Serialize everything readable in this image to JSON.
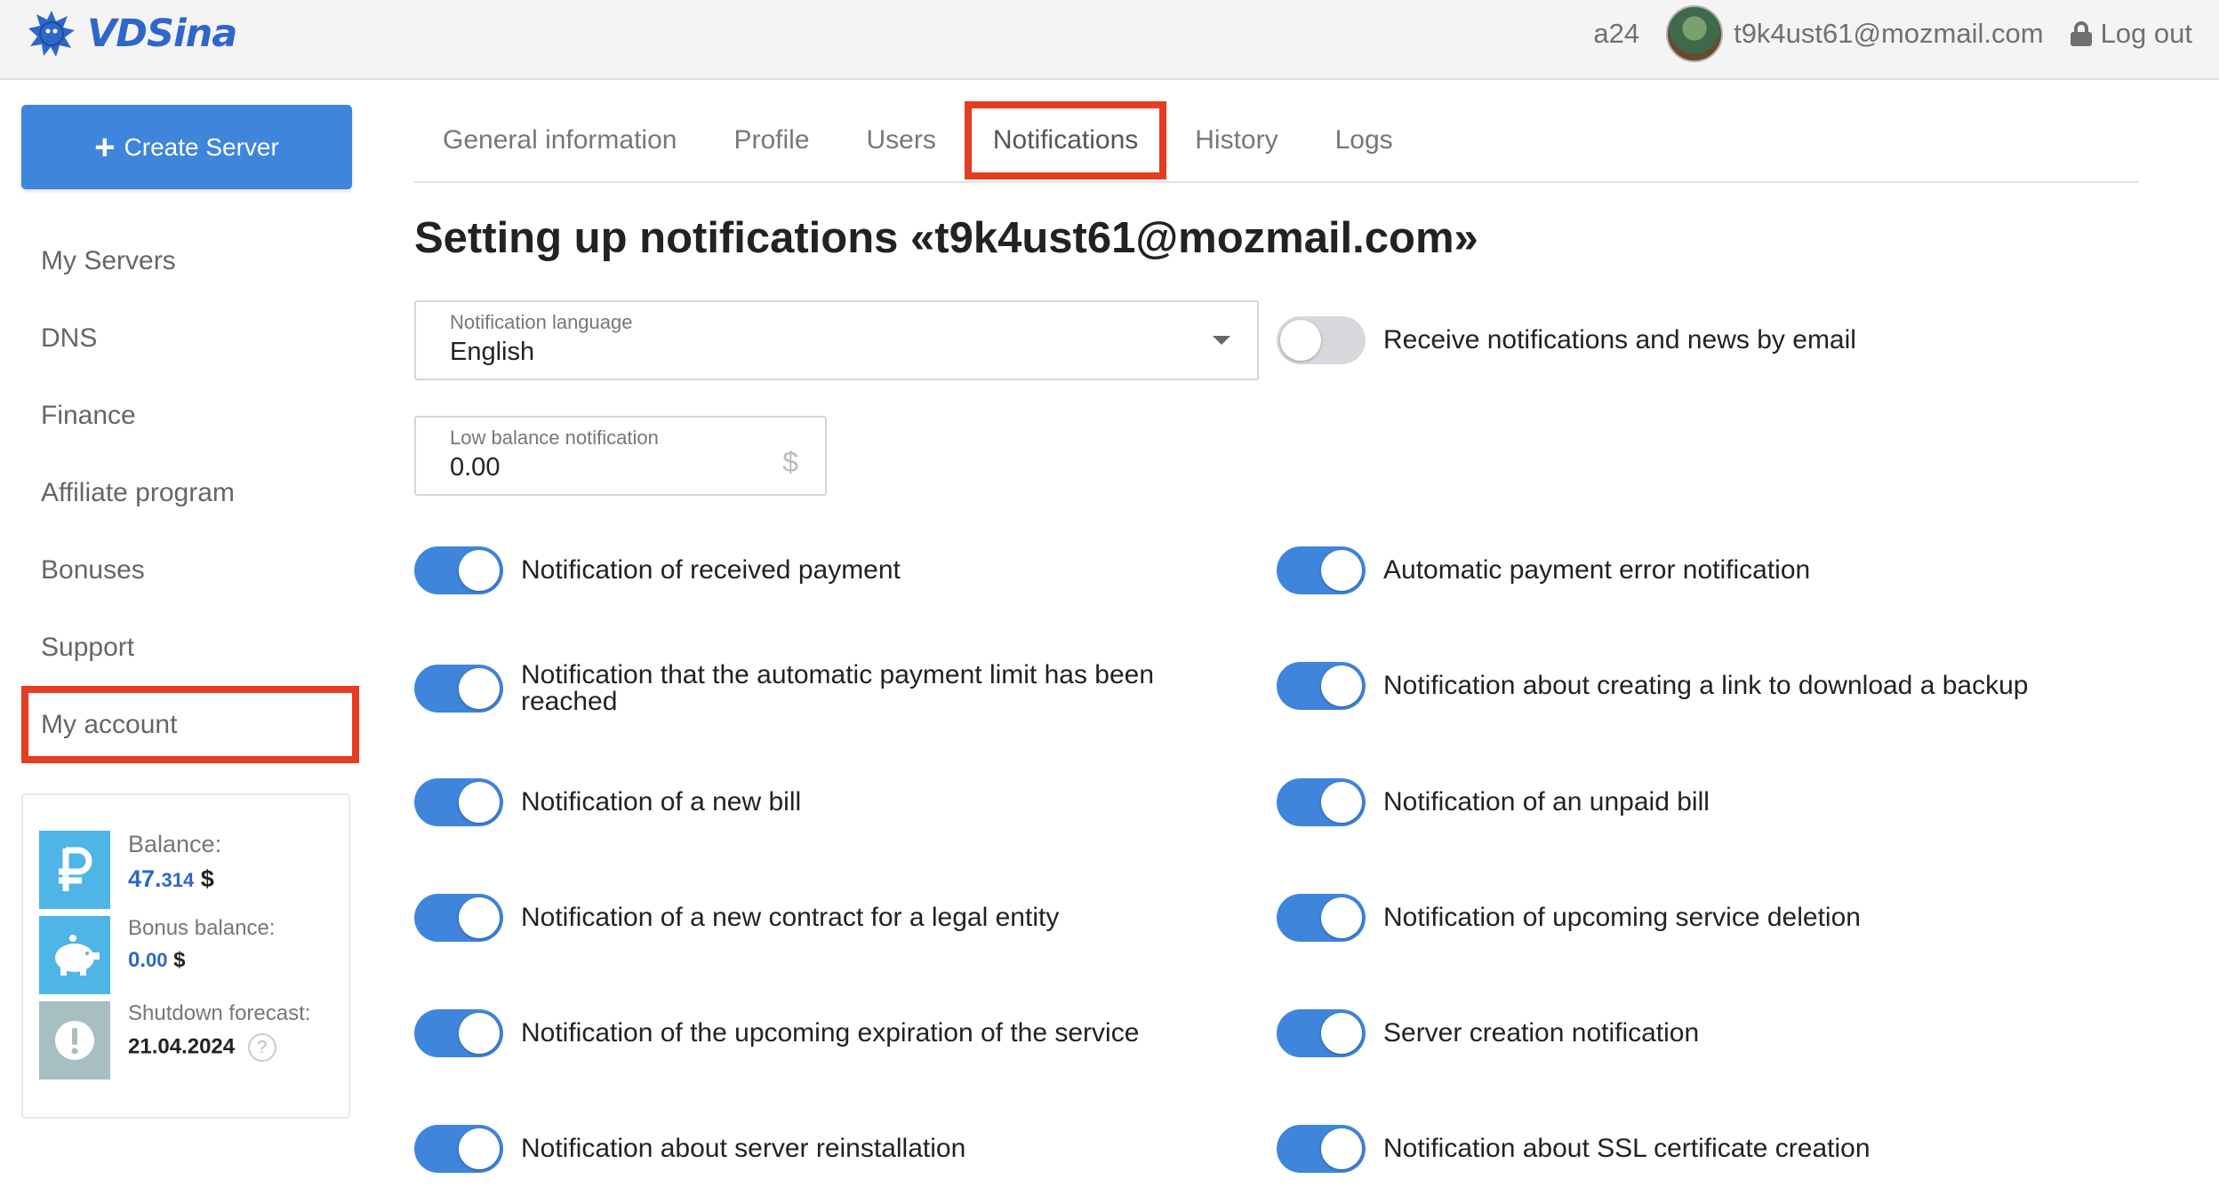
{
  "header": {
    "logo_text": "VDSina",
    "account_code": "a24",
    "user_email": "t9k4ust61@mozmail.com",
    "logout_label": "Log out"
  },
  "sidebar": {
    "create_server_label": "Create Server",
    "items": [
      {
        "label": "My Servers"
      },
      {
        "label": "DNS"
      },
      {
        "label": "Finance"
      },
      {
        "label": "Affiliate program"
      },
      {
        "label": "Bonuses"
      },
      {
        "label": "Support"
      },
      {
        "label": "My account"
      }
    ],
    "balance": {
      "label": "Balance:",
      "value_int": "47.",
      "value_dec": "314",
      "currency": "$",
      "bonus_label": "Bonus balance:",
      "bonus_int": "0.",
      "bonus_dec": "00",
      "bonus_currency": "$",
      "forecast_label": "Shutdown forecast:",
      "forecast_date": "21.04.2024",
      "help_glyph": "?"
    }
  },
  "tabs": [
    {
      "label": "General information"
    },
    {
      "label": "Profile"
    },
    {
      "label": "Users"
    },
    {
      "label": "Notifications"
    },
    {
      "label": "History"
    },
    {
      "label": "Logs"
    }
  ],
  "page_title": "Setting up notifications «t9k4ust61@mozmail.com»",
  "language_field": {
    "label": "Notification language",
    "value": "English"
  },
  "low_balance_field": {
    "label": "Low balance notification",
    "value": "0.00",
    "suffix": "$"
  },
  "email_toggle": {
    "label": "Receive notifications and news by email",
    "on": false
  },
  "toggles_left": [
    {
      "label": "Notification of received payment",
      "on": true
    },
    {
      "label": "Notification that the automatic payment limit has been reached",
      "on": true
    },
    {
      "label": "Notification of a new bill",
      "on": true
    },
    {
      "label": "Notification of a new contract for a legal entity",
      "on": true
    },
    {
      "label": "Notification of the upcoming expiration of the service",
      "on": true
    },
    {
      "label": "Notification about server reinstallation",
      "on": true
    }
  ],
  "toggles_right": [
    {
      "label": "Automatic payment error notification",
      "on": true
    },
    {
      "label": "Notification about creating a link to download a backup",
      "on": true
    },
    {
      "label": "Notification of an unpaid bill",
      "on": true
    },
    {
      "label": "Notification of upcoming service deletion",
      "on": true
    },
    {
      "label": "Server creation notification",
      "on": true
    },
    {
      "label": "Notification about SSL certificate creation",
      "on": true
    }
  ],
  "colors": {
    "accent": "#3f85db",
    "highlight": "#e53d22",
    "toggle_off": "#d7d8dc"
  }
}
